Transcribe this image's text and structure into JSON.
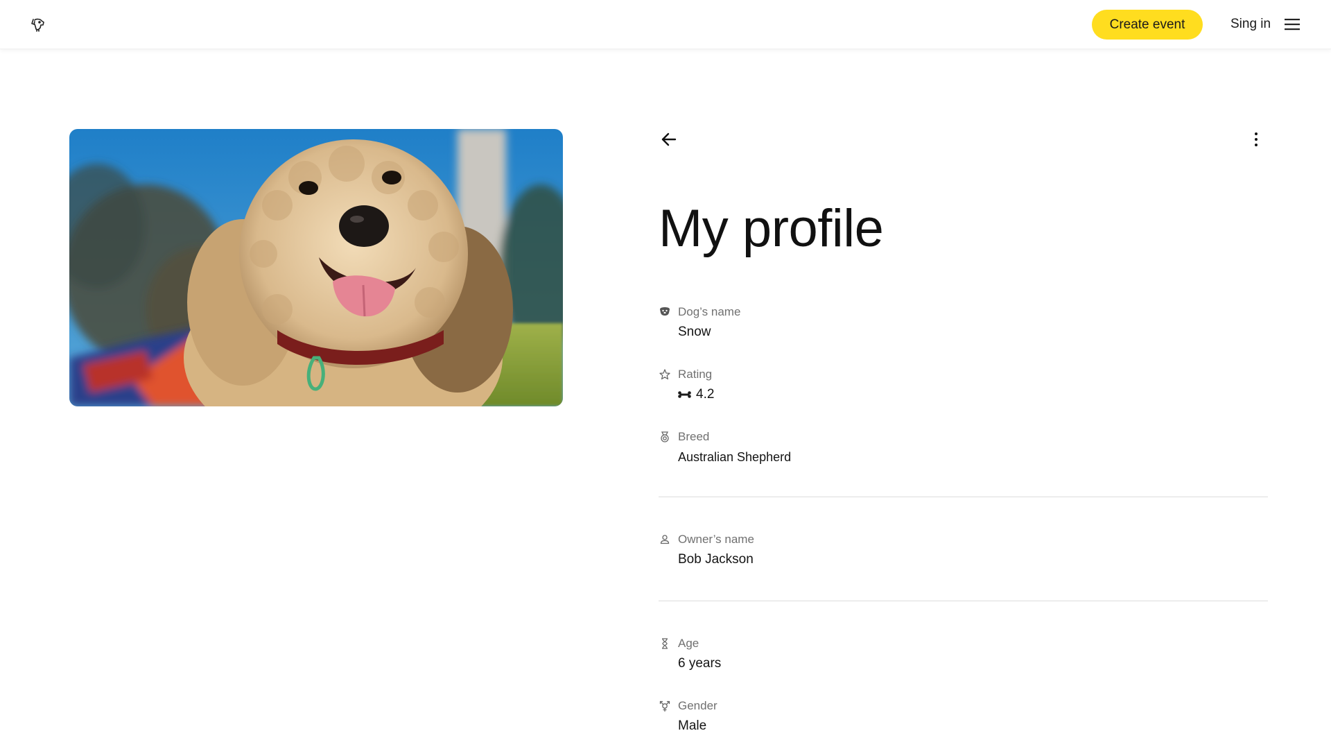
{
  "header": {
    "logo_icon": "dog-head-icon",
    "create_event_label": "Create event",
    "signin_label": "Sing in",
    "menu_icon": "hamburger-menu-icon",
    "accent_color": "#ffdd1f"
  },
  "main": {
    "photo_icon": "dog-photo",
    "back_icon": "arrow-left-icon",
    "more_icon": "more-vertical-icon",
    "title": "My profile",
    "fields": [
      {
        "icon": "dog-face-icon",
        "label": "Dog’s name",
        "value": "Snow"
      },
      {
        "icon": "star-icon",
        "label": "Rating",
        "value": "4.2",
        "value_icon": "bone-icon"
      },
      {
        "icon": "medal-icon",
        "label": "Breed",
        "value": "Australian Shepherd"
      },
      {
        "icon": "person-icon",
        "label": "Owner’s name",
        "value": "Bob Jackson"
      },
      {
        "icon": "hourglass-icon",
        "label": "Age",
        "value": "6 years"
      },
      {
        "icon": "gender-icon",
        "label": "Gender",
        "value": "Male"
      }
    ]
  }
}
